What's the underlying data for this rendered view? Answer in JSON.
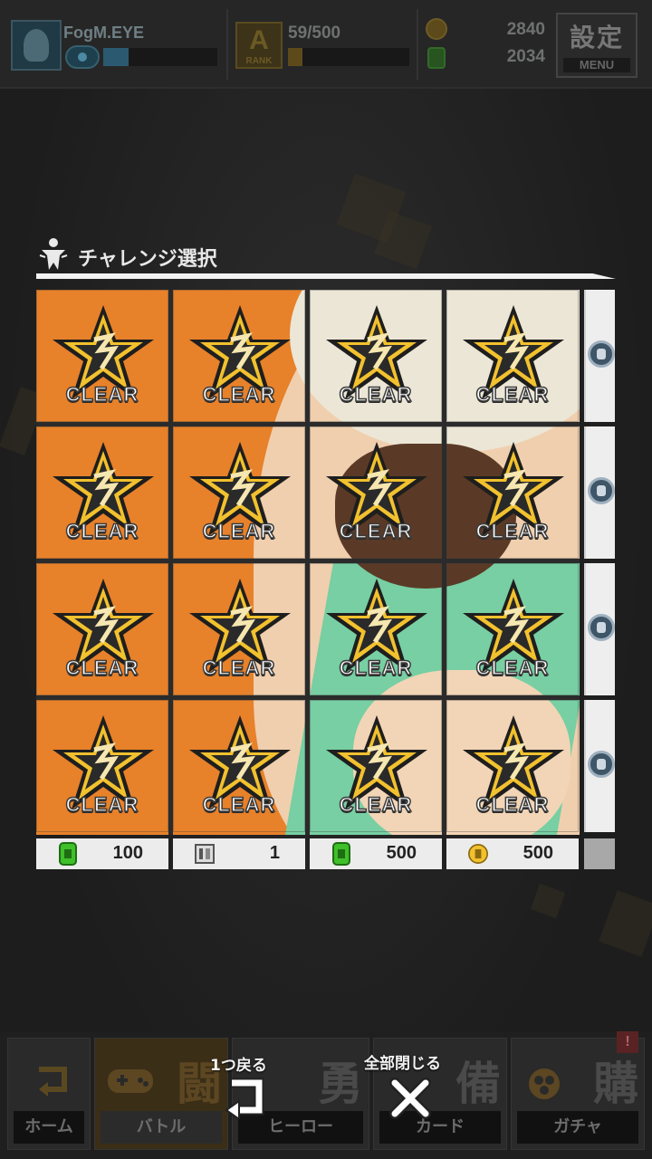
{
  "header": {
    "player_name": "FogM.EYE",
    "rank_letter": "A",
    "rank_label": "RANK",
    "rank_progress": "59/500",
    "xp_fraction": 0.22,
    "rank_fraction": 0.12,
    "coins": "2840",
    "fuel": "2034",
    "menu_kanji": "設定",
    "menu_label": "MENU"
  },
  "panel": {
    "title": "チャレンジ選択",
    "cells": [
      [
        "CLEAR",
        "CLEAR",
        "CLEAR",
        "CLEAR"
      ],
      [
        "CLEAR",
        "CLEAR",
        "CLEAR",
        "CLEAR"
      ],
      [
        "CLEAR",
        "CLEAR",
        "CLEAR",
        "CLEAR"
      ],
      [
        "CLEAR",
        "CLEAR",
        "CLEAR",
        "CLEAR"
      ]
    ],
    "rewards": [
      {
        "icon": "fuel-icon",
        "value": "100"
      },
      {
        "icon": "ticket-icon",
        "value": "1"
      },
      {
        "icon": "fuel-icon",
        "value": "500"
      },
      {
        "icon": "coin-icon",
        "value": "500"
      }
    ]
  },
  "nav": [
    {
      "label": "ホーム",
      "glyph": ""
    },
    {
      "label": "バトル",
      "glyph": "闘"
    },
    {
      "label": "ヒーロー",
      "glyph": "勇"
    },
    {
      "label": "カード",
      "glyph": "備"
    },
    {
      "label": "ガチャ",
      "glyph": "購",
      "badge": "!"
    }
  ],
  "actions": {
    "back_label": "1つ戻る",
    "close_all_label": "全部閉じる"
  },
  "colors": {
    "accent_orange": "#e7812a",
    "star_gold": "#f2c12e",
    "panel_white": "#f2f2f2"
  }
}
